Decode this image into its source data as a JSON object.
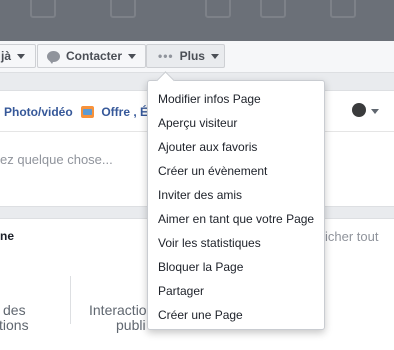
{
  "action_bar": {
    "partial_button_label": "jà",
    "contact_button_label": "Contacter",
    "more_button_label": "Plus"
  },
  "composer": {
    "photo_tab_label": "Photo/vidéo",
    "offer_tab_label": "Offre , É",
    "placeholder": "ez quelque chose..."
  },
  "stats": {
    "title": "ne",
    "see_all_link": "fficher tout",
    "label_left_line1": "des",
    "label_left_line2": "tions",
    "label_mid_line1": "Interaction",
    "label_mid_line2": "publi"
  },
  "dropdown_menu": {
    "items": [
      {
        "label": "Modifier infos Page"
      },
      {
        "label": "Aperçu visiteur"
      },
      {
        "label": "Ajouter aux favoris"
      },
      {
        "label": "Créer un évènement"
      },
      {
        "label": "Inviter des amis"
      },
      {
        "label": "Aimer en tant que votre Page"
      },
      {
        "label": "Voir les statistiques"
      },
      {
        "label": "Bloquer la Page"
      },
      {
        "label": "Partager"
      },
      {
        "label": "Créer une Page"
      }
    ]
  },
  "colors": {
    "link_blue": "#365899",
    "highlight_blue": "#4267b2",
    "cover_gray": "#6b7078",
    "page_bg": "#e9ebee"
  }
}
